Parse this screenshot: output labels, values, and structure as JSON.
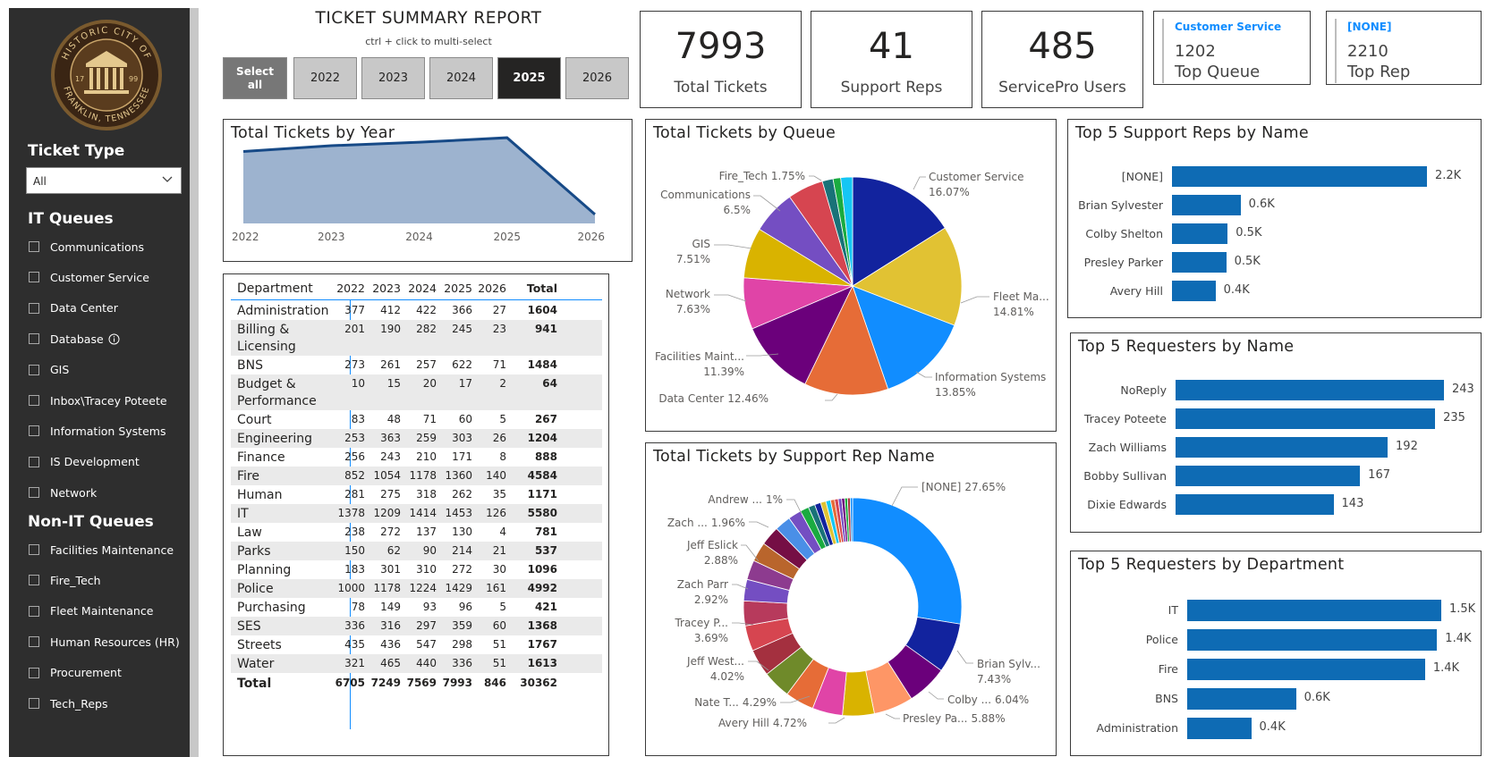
{
  "sidebar": {
    "logo_text": {
      "top": "HISTORIC CITY OF",
      "bottom": "FRANKLIN, TENNESSEE",
      "left_year": "17",
      "right_year": "99"
    },
    "ticket_type_label": "Ticket Type",
    "ticket_type_value": "All",
    "it_queues_label": "IT Queues",
    "it_queues": [
      "Communications",
      "Customer Service",
      "Data Center",
      "Database",
      "GIS",
      "Inbox\\Tracey Poteete",
      "Information Systems",
      "IS Development",
      "Network"
    ],
    "non_it_queues_label": "Non-IT Queues",
    "non_it_queues": [
      "Facilities Maintenance",
      "Fire_Tech",
      "Fleet Maintenance",
      "Human Resources (HR)",
      "Procurement",
      "Tech_Reps"
    ]
  },
  "header": {
    "title": "TICKET SUMMARY REPORT",
    "subtitle": "ctrl + click to multi-select",
    "select_all_line1": "Select",
    "select_all_line2": "all",
    "years": [
      "2022",
      "2023",
      "2024",
      "2025",
      "2026"
    ],
    "selected_year": "2025"
  },
  "kpis": {
    "total_tickets": {
      "value": "7993",
      "label": "Total Tickets"
    },
    "support_reps": {
      "value": "41",
      "label": "Support Reps"
    },
    "servicepro_users": {
      "value": "485",
      "label": "ServicePro Users"
    },
    "top_queue": {
      "name": "Customer Service",
      "value": "1202",
      "caption": "Top Queue"
    },
    "top_rep": {
      "name": "[NONE]",
      "value": "2210",
      "caption": "Top Rep"
    }
  },
  "colors": {
    "bar": "#0e6bb4",
    "accent": "#118dff",
    "sidebar": "#2e2e2e",
    "selected_button": "#252423"
  },
  "year_chart": {
    "title": "Total Tickets by Year",
    "chart_data": {
      "type": "area",
      "x": [
        "2022",
        "2023",
        "2024",
        "2025",
        "2026"
      ],
      "values": [
        6705,
        7249,
        7569,
        7993,
        846
      ],
      "ylim": [
        0,
        8000
      ]
    }
  },
  "dept_table": {
    "headers": [
      "Department",
      "2022",
      "2023",
      "2024",
      "2025",
      "2026",
      "Total"
    ],
    "rows": [
      [
        "Administration",
        "377",
        "412",
        "422",
        "366",
        "27",
        "1604"
      ],
      [
        "Billing & Licensing",
        "201",
        "190",
        "282",
        "245",
        "23",
        "941"
      ],
      [
        "BNS",
        "273",
        "261",
        "257",
        "622",
        "71",
        "1484"
      ],
      [
        "Budget & Performance",
        "10",
        "15",
        "20",
        "17",
        "2",
        "64"
      ],
      [
        "Court",
        "83",
        "48",
        "71",
        "60",
        "5",
        "267"
      ],
      [
        "Engineering",
        "253",
        "363",
        "259",
        "303",
        "26",
        "1204"
      ],
      [
        "Finance",
        "256",
        "243",
        "210",
        "171",
        "8",
        "888"
      ],
      [
        "Fire",
        "852",
        "1054",
        "1178",
        "1360",
        "140",
        "4584"
      ],
      [
        "Human Resources",
        "281",
        "275",
        "318",
        "262",
        "35",
        "1171"
      ],
      [
        "IT",
        "1378",
        "1209",
        "1414",
        "1453",
        "126",
        "5580"
      ],
      [
        "Law",
        "238",
        "272",
        "137",
        "130",
        "4",
        "781"
      ],
      [
        "Parks",
        "150",
        "62",
        "90",
        "214",
        "21",
        "537"
      ],
      [
        "Planning",
        "183",
        "301",
        "310",
        "272",
        "30",
        "1096"
      ],
      [
        "Police",
        "1000",
        "1178",
        "1224",
        "1429",
        "161",
        "4992"
      ],
      [
        "Purchasing",
        "78",
        "149",
        "93",
        "96",
        "5",
        "421"
      ],
      [
        "SES",
        "336",
        "316",
        "297",
        "359",
        "60",
        "1368"
      ],
      [
        "Streets",
        "435",
        "436",
        "547",
        "298",
        "51",
        "1767"
      ],
      [
        "Water",
        "321",
        "465",
        "440",
        "336",
        "51",
        "1613"
      ]
    ],
    "total_row": [
      "Total",
      "6705",
      "7249",
      "7569",
      "7993",
      "846",
      "30362"
    ]
  },
  "queue_pie": {
    "title": "Total Tickets by Queue",
    "chart_data": {
      "type": "pie",
      "slices": [
        {
          "label": "Customer Service",
          "pct": 16.07,
          "color": "#12239e"
        },
        {
          "label": "Fleet Ma...",
          "pct": 14.81,
          "color": "#e1c233"
        },
        {
          "label": "Information Systems",
          "pct": 13.85,
          "color": "#118dff"
        },
        {
          "label": "Data Center",
          "pct": 12.46,
          "color": "#e66c37"
        },
        {
          "label": "Facilities Maint...",
          "pct": 11.39,
          "color": "#6b007b"
        },
        {
          "label": "Network",
          "pct": 7.63,
          "color": "#e044a7"
        },
        {
          "label": "GIS",
          "pct": 7.51,
          "color": "#d9b300"
        },
        {
          "label": "Communications",
          "pct": 6.5,
          "color": "#744ec2"
        },
        {
          "label": "",
          "pct": 5.3,
          "color": "#d64550"
        },
        {
          "label": "",
          "pct": 1.6,
          "color": "#197278"
        },
        {
          "label": "",
          "pct": 1.13,
          "color": "#1aab40"
        },
        {
          "label": "Fire_Tech",
          "pct": 1.75,
          "color": "#15c6f4"
        }
      ],
      "labels": [
        {
          "name": "Customer Service",
          "pct": "16.07%"
        },
        {
          "name": "Fleet Ma...",
          "pct": "14.81%"
        },
        {
          "name": "Information Systems",
          "pct": "13.85%"
        },
        {
          "name": "Data Center",
          "pct": "12.46%"
        },
        {
          "name": "Facilities Maint...",
          "pct": "11.39%"
        },
        {
          "name": "Network",
          "pct": "7.63%"
        },
        {
          "name": "GIS",
          "pct": "7.51%"
        },
        {
          "name": "Communications",
          "pct": "6.5%"
        },
        {
          "name": "Fire_Tech",
          "pct": "1.75%"
        }
      ]
    }
  },
  "rep_donut": {
    "title": "Total Tickets by Support Rep Name",
    "chart_data": {
      "type": "pie",
      "slices": [
        {
          "label": "[NONE]",
          "pct": 27.65,
          "color": "#118dff"
        },
        {
          "label": "Brian Sylv...",
          "pct": 7.43,
          "color": "#12239e"
        },
        {
          "label": "Colby ...",
          "pct": 6.04,
          "color": "#6b007b"
        },
        {
          "label": "Presley Pa...",
          "pct": 5.88,
          "color": "#fe9666"
        },
        {
          "label": "Avery Hill",
          "pct": 4.72,
          "color": "#d9b300"
        },
        {
          "label": "",
          "pct": 4.5,
          "color": "#e044a7"
        },
        {
          "label": "Nate T...",
          "pct": 4.29,
          "color": "#e66c37"
        },
        {
          "label": "",
          "pct": 4.2,
          "color": "#6f8a2a"
        },
        {
          "label": "Jeff West...",
          "pct": 4.02,
          "color": "#a4303f"
        },
        {
          "label": "",
          "pct": 3.8,
          "color": "#d64550"
        },
        {
          "label": "Tracey P...",
          "pct": 3.69,
          "color": "#b73a5c"
        },
        {
          "label": "",
          "pct": 3.2,
          "color": "#744ec2"
        },
        {
          "label": "Zach Parr",
          "pct": 2.92,
          "color": "#8d3b8f"
        },
        {
          "label": "",
          "pct": 2.9,
          "color": "#b9652c"
        },
        {
          "label": "Jeff Eslick",
          "pct": 2.88,
          "color": "#750e45"
        },
        {
          "label": "",
          "pct": 2.4,
          "color": "#4a8fe7"
        },
        {
          "label": "Zach ...",
          "pct": 1.96,
          "color": "#744ec2"
        },
        {
          "label": "",
          "pct": 1.3,
          "color": "#1aab40"
        },
        {
          "label": "Andrew ...",
          "pct": 1.0,
          "color": "#197278"
        },
        {
          "label": "",
          "pct": 0.9,
          "color": "#12239e"
        },
        {
          "label": "",
          "pct": 0.8,
          "color": "#e1c233"
        },
        {
          "label": "",
          "pct": 0.7,
          "color": "#15c6f4"
        },
        {
          "label": "",
          "pct": 0.6,
          "color": "#e66c37"
        },
        {
          "label": "",
          "pct": 0.55,
          "color": "#d64550"
        },
        {
          "label": "",
          "pct": 0.5,
          "color": "#744ec2"
        },
        {
          "label": "",
          "pct": 0.45,
          "color": "#6b007b"
        },
        {
          "label": "",
          "pct": 0.42,
          "color": "#1aab40"
        },
        {
          "label": "",
          "pct": 0.4,
          "color": "#a4303f"
        },
        {
          "label": "",
          "pct": 0.35,
          "color": "#118dff"
        }
      ],
      "labels": [
        {
          "name": "[NONE]",
          "pct": "27.65%"
        },
        {
          "name": "Brian Sylv...",
          "pct": "7.43%"
        },
        {
          "name": "Colby ...",
          "pct": "6.04%"
        },
        {
          "name": "Presley Pa...",
          "pct": "5.88%"
        },
        {
          "name": "Avery Hill",
          "pct": "4.72%"
        },
        {
          "name": "Nate T...",
          "pct": "4.29%"
        },
        {
          "name": "Jeff West...",
          "pct": "4.02%"
        },
        {
          "name": "Tracey P...",
          "pct": "3.69%"
        },
        {
          "name": "Zach Parr",
          "pct": "2.92%"
        },
        {
          "name": "Jeff Eslick",
          "pct": "2.88%"
        },
        {
          "name": "Zach ...",
          "pct": "1.96%"
        },
        {
          "name": "Andrew ...",
          "pct": "1%"
        }
      ]
    }
  },
  "top_reps": {
    "title": "Top 5 Support Reps by Name",
    "chart_data": {
      "type": "bar",
      "categories": [
        "[NONE]",
        "Brian Sylvester",
        "Colby Shelton",
        "Presley Parker",
        "Avery Hill"
      ],
      "values": [
        2210,
        594,
        483,
        470,
        377
      ],
      "labels": [
        "2.2K",
        "0.6K",
        "0.5K",
        "0.5K",
        "0.4K"
      ]
    }
  },
  "top_requesters": {
    "title": "Top 5 Requesters by Name",
    "chart_data": {
      "type": "bar",
      "categories": [
        "NoReply",
        "Tracey Poteete",
        "Zach Williams",
        "Bobby Sullivan",
        "Dixie Edwards"
      ],
      "values": [
        243,
        235,
        192,
        167,
        143
      ],
      "labels": [
        "243",
        "235",
        "192",
        "167",
        "143"
      ]
    }
  },
  "top_depts": {
    "title": "Top 5 Requesters by Department",
    "chart_data": {
      "type": "bar",
      "categories": [
        "IT",
        "Police",
        "Fire",
        "BNS",
        "Administration"
      ],
      "values": [
        1453,
        1429,
        1360,
        622,
        366
      ],
      "labels": [
        "1.5K",
        "1.4K",
        "1.4K",
        "0.6K",
        "0.4K"
      ]
    }
  }
}
